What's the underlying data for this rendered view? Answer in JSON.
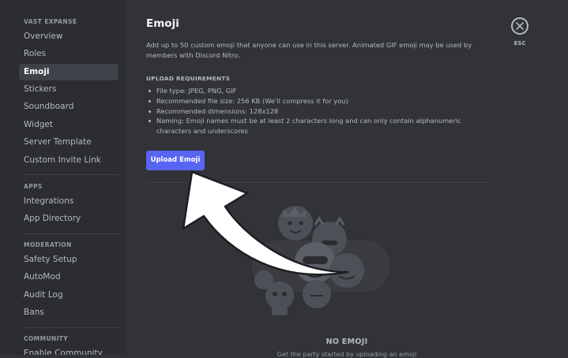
{
  "sidebar": {
    "server_name": "VAST EXPANSE",
    "items_top": [
      {
        "label": "Overview"
      },
      {
        "label": "Roles"
      },
      {
        "label": "Emoji"
      },
      {
        "label": "Stickers"
      },
      {
        "label": "Soundboard"
      },
      {
        "label": "Widget"
      },
      {
        "label": "Server Template"
      },
      {
        "label": "Custom Invite Link"
      }
    ],
    "apps_header": "APPS",
    "apps_items": [
      {
        "label": "Integrations"
      },
      {
        "label": "App Directory"
      }
    ],
    "moderation_header": "MODERATION",
    "moderation_items": [
      {
        "label": "Safety Setup"
      },
      {
        "label": "AutoMod"
      },
      {
        "label": "Audit Log"
      },
      {
        "label": "Bans"
      }
    ],
    "community_header": "COMMUNITY",
    "community_items": [
      {
        "label": "Enable Community"
      }
    ]
  },
  "main": {
    "title": "Emoji",
    "description": "Add up to 50 custom emoji that anyone can use in this server. Animated GIF emoji may be used by members with Discord Nitro.",
    "requirements_title": "UPLOAD REQUIREMENTS",
    "requirements": [
      "File type: JPEG, PNG, GIF",
      "Recommended file size: 256 KB (We'll compress it for you)",
      "Recommended dimensions: 128x128",
      "Naming: Emoji names must be at least 2 characters long and can only contain alphanumeric characters and underscores"
    ],
    "upload_button": "Upload Emoji",
    "empty_title": "NO EMOJI",
    "empty_subtitle": "Get the party started by uploading an emoji"
  },
  "close": {
    "label": "ESC",
    "icon": "close-icon"
  },
  "colors": {
    "accent": "#5865f2",
    "background": "#313338",
    "sidebar": "#2b2d31"
  }
}
